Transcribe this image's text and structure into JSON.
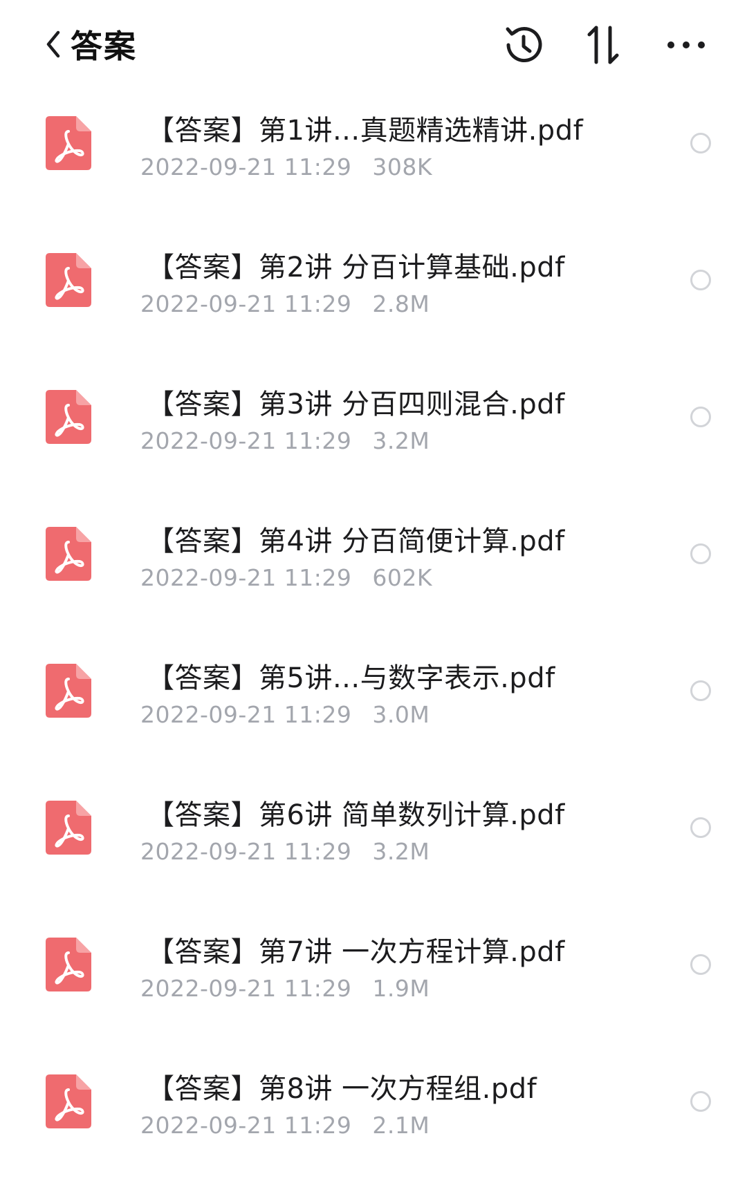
{
  "header": {
    "title": "答案",
    "back_icon": "chevron-left-icon",
    "history_icon": "history-icon",
    "sort_icon": "sort-icon",
    "more_icon": "more-icon"
  },
  "colors": {
    "pdf_icon": "#ef6b6f",
    "meta_text": "#a3a6ad",
    "radio_border": "#d2d4d8"
  },
  "files": [
    {
      "name": "【答案】第1讲...真题精选精讲.pdf",
      "date": "2022-09-21 11:29",
      "size": "308K"
    },
    {
      "name": "【答案】第2讲 分百计算基础.pdf",
      "date": "2022-09-21 11:29",
      "size": "2.8M"
    },
    {
      "name": "【答案】第3讲 分百四则混合.pdf",
      "date": "2022-09-21 11:29",
      "size": "3.2M"
    },
    {
      "name": "【答案】第4讲 分百简便计算.pdf",
      "date": "2022-09-21 11:29",
      "size": "602K"
    },
    {
      "name": "【答案】第5讲...与数字表示.pdf",
      "date": "2022-09-21 11:29",
      "size": "3.0M"
    },
    {
      "name": "【答案】第6讲 简单数列计算.pdf",
      "date": "2022-09-21 11:29",
      "size": "3.2M"
    },
    {
      "name": "【答案】第7讲 一次方程计算.pdf",
      "date": "2022-09-21 11:29",
      "size": "1.9M"
    },
    {
      "name": "【答案】第8讲 一次方程组.pdf",
      "date": "2022-09-21 11:29",
      "size": "2.1M"
    }
  ]
}
